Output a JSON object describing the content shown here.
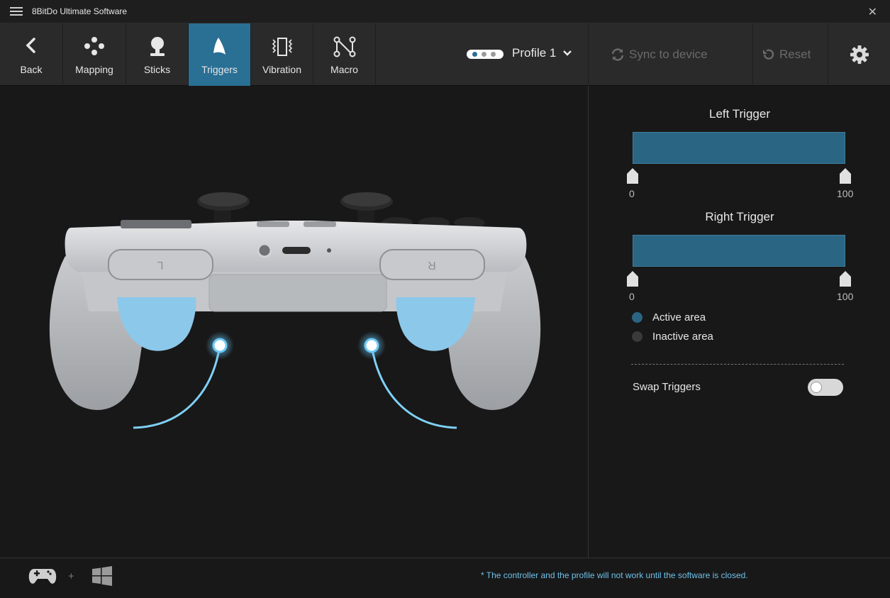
{
  "window": {
    "title": "8BitDo Ultimate Software",
    "close_glyph": "✕"
  },
  "toolbar": {
    "tabs": [
      {
        "label": "Back",
        "icon": "chevron-left-icon"
      },
      {
        "label": "Mapping",
        "icon": "dpad-dots-icon"
      },
      {
        "label": "Sticks",
        "icon": "joystick-icon"
      },
      {
        "label": "Triggers",
        "icon": "trigger-icon",
        "active": true
      },
      {
        "label": "Vibration",
        "icon": "vibration-icon"
      },
      {
        "label": "Macro",
        "icon": "macro-nodes-icon"
      }
    ],
    "profile": {
      "name": "Profile 1",
      "active_index": 0
    },
    "sync_label": "Sync to device",
    "reset_label": "Reset",
    "settings_icon": "gear-icon"
  },
  "panel": {
    "left_trigger": {
      "title": "Left Trigger",
      "min": "0",
      "max": "100"
    },
    "right_trigger": {
      "title": "Right Trigger",
      "min": "0",
      "max": "100"
    },
    "legend": {
      "active": "Active area",
      "inactive": "Inactive area"
    },
    "swap_label": "Swap Triggers",
    "swap_on": false
  },
  "colors": {
    "accent": "#2a6f94",
    "bar": "#2a6583",
    "glow": "#7fd0f5",
    "trigger": "#8cc8ea"
  },
  "footer": {
    "note": "* The controller and the profile will not work until the software is closed.",
    "plus": "+"
  }
}
